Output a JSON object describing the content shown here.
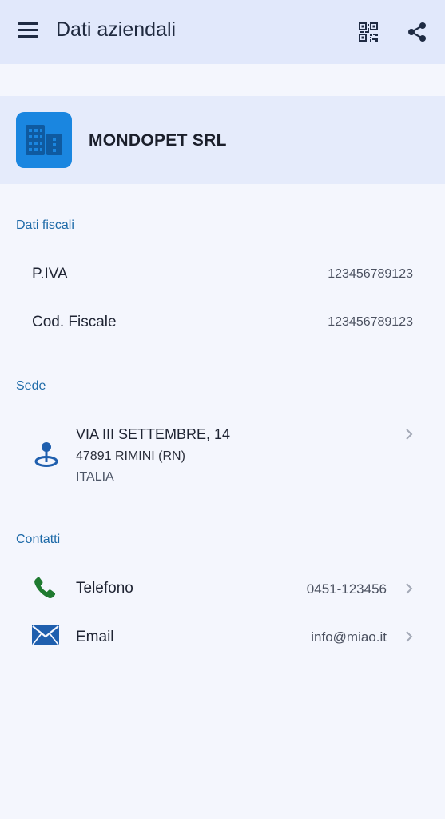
{
  "header": {
    "title": "Dati aziendali",
    "menu_icon": "hamburger-menu-icon",
    "qr_icon": "qr-code-icon",
    "share_icon": "share-icon"
  },
  "company": {
    "name": "MONDOPET SRL",
    "logo_icon": "building-icon",
    "logo_color": "#1a86e0"
  },
  "fiscal": {
    "section_title": "Dati fiscali",
    "rows": [
      {
        "label": "P.IVA",
        "value": "123456789123"
      },
      {
        "label": "Cod. Fiscale",
        "value": "123456789123"
      }
    ]
  },
  "address": {
    "section_title": "Sede",
    "line1": "VIA III SETTEMBRE, 14",
    "line2": "47891 RIMINI (RN)",
    "line3": "ITALIA",
    "icon": "location-pin-icon"
  },
  "contacts": {
    "section_title": "Contatti",
    "items": [
      {
        "label": "Telefono",
        "value": "0451-123456",
        "icon": "phone-icon",
        "icon_color": "#1f7a30"
      },
      {
        "label": "Email",
        "value": "info@miao.it",
        "icon": "email-icon",
        "icon_color": "#1f5fae"
      }
    ]
  },
  "colors": {
    "accent": "#1d6aa8",
    "appbar_bg": "#e1e8fb",
    "background": "#f4f6fd"
  }
}
